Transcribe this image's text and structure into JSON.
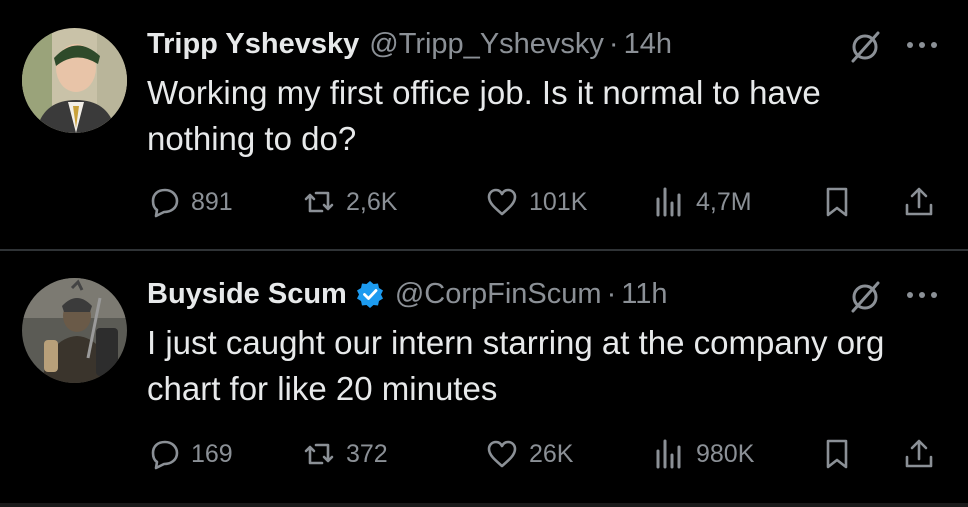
{
  "tweets": [
    {
      "name": "Tripp Yshevsky",
      "handle": "@Tripp_Yshevsky",
      "separator": "·",
      "time": "14h",
      "verified": false,
      "text": "Working my first office job. Is it normal to have nothing to do?",
      "replies": "891",
      "retweets": "2,6K",
      "likes": "101K",
      "views": "4,7M"
    },
    {
      "name": "Buyside Scum",
      "handle": "@CorpFinScum",
      "separator": "·",
      "time": "11h",
      "verified": true,
      "text": "I just caught our intern starring at the company org chart for like 20 minutes",
      "replies": "169",
      "retweets": "372",
      "likes": "26K",
      "views": "980K"
    }
  ],
  "colors": {
    "background": "#000000",
    "primary_text": "#e7e9ea",
    "secondary_text": "#8b9096",
    "divider": "#2f3336",
    "verified_blue": "#1d9bf0"
  }
}
